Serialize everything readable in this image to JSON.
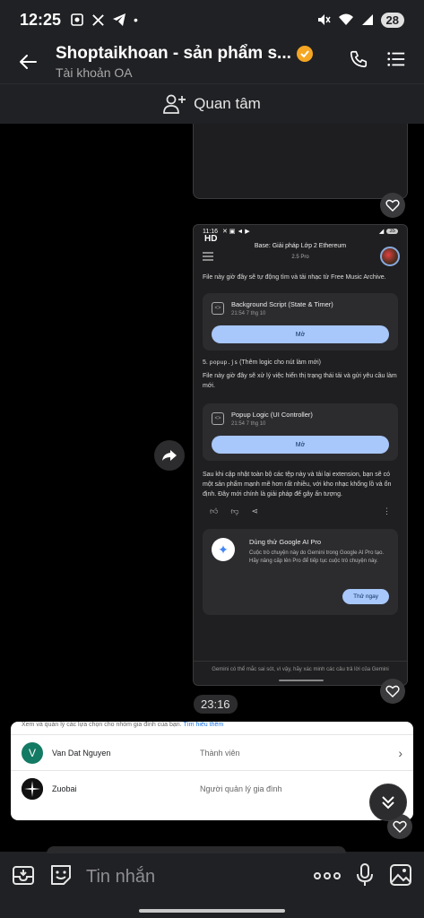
{
  "status": {
    "time": "12:25",
    "battery": "28"
  },
  "header": {
    "title": "Shoptaikhoan - sản phẩm s...",
    "subtitle": "Tài khoản OA"
  },
  "follow": {
    "label": "Quan tâm"
  },
  "screenshot": {
    "status_time": "11:16",
    "hd": "HD",
    "battery": "35",
    "title": "Base: Giải pháp Lớp 2 Ethereum",
    "model": "2.5 Pro",
    "para1": "File này giờ đây sẽ tự động tìm và tải nhạc từ Free Music Archive.",
    "file1": {
      "name": "Background Script (State & Timer)",
      "date": "21:54 7 thg 10",
      "open": "Mở"
    },
    "step5_code": "popup.js",
    "step5_num": "5.",
    "step5_text": "(Thêm logic cho nút làm mới)",
    "para2": "File này giờ đây sẽ xử lý việc hiển thị trạng thái tải và gửi yêu cầu làm mới.",
    "file2": {
      "name": "Popup Logic (UI Controller)",
      "date": "21:54 7 thg 10",
      "open": "Mở"
    },
    "para3": "Sau khi cập nhật toàn bộ các tệp này và tải lại extension, bạn sẽ có một sản phẩm mạnh mẽ hơn rất nhiều, với kho nhạc khổng lồ và ổn định. Đây mới chính là giải pháp để gây ấn tượng.",
    "promo": {
      "title": "Dùng thử Google AI Pro",
      "desc": "Cuộc trò chuyện này do Gemini trong Google AI Pro tạo. Hãy nâng cấp lên Pro để tiếp tục cuộc trò chuyện này.",
      "button": "Thử ngay"
    },
    "footer": "Gemini có thể mắc sai sót, vì vậy, hãy xác minh các câu trả lời của Gemini"
  },
  "chat": {
    "timestamp": "23:16"
  },
  "family_card": {
    "top_text": "Xem và quản lý các lựa chọn cho nhóm gia đình của bạn.",
    "top_link": "Tìm hiểu thêm",
    "members": [
      {
        "initial": "V",
        "name": "Van Dat Nguyen",
        "role": "Thành viên",
        "color": "#137a63"
      },
      {
        "initial": "",
        "name": "Zuobai",
        "role": "Người quản lý gia đình",
        "color": "#111111"
      }
    ]
  },
  "composer": {
    "placeholder": "Tin nhắn"
  },
  "colors": {
    "accent": "#f5a623",
    "gemini_button": "#a8c7fa"
  }
}
